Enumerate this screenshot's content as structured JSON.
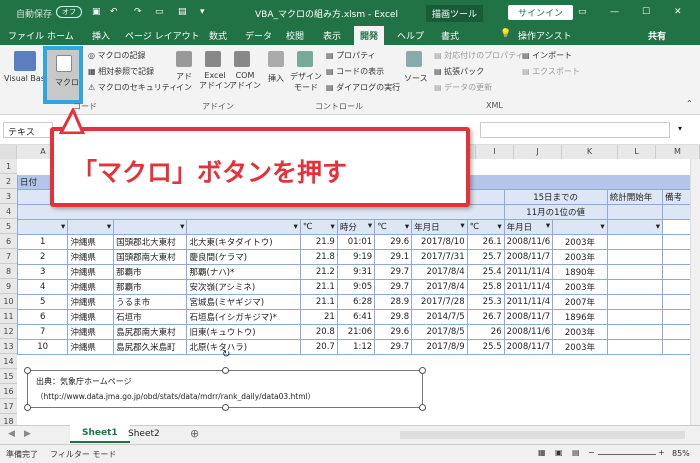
{
  "titlebar": {
    "autosave": "自動保存",
    "autosave_state": "オフ",
    "doc_title": "VBA_マクロの組み方.xlsm - Excel",
    "context_tab": "描画ツール",
    "signin": "サインイン"
  },
  "ribbon_tabs": [
    "ファイル",
    "ホーム",
    "挿入",
    "ページ レイアウト",
    "数式",
    "データ",
    "校閲",
    "表示",
    "開発",
    "ヘルプ",
    "書式"
  ],
  "tell_me": "操作アシスト",
  "share": "共有",
  "ribbon": {
    "visual_basic": "Visual Basic",
    "macro": "マクロ",
    "record_macro": "マクロの記録",
    "relative_ref": "相対参照で記録",
    "macro_security": "マクロのセキュリティ",
    "code_group": "コード",
    "addin": "アド\nイン",
    "excel_addin": "Excel\nアドイン",
    "com_addin": "COM\nアドイン",
    "addin_group": "アドイン",
    "insert": "挿入",
    "design_mode": "デザイン\nモード",
    "properties": "プロパティ",
    "view_code": "コードの表示",
    "run_dialog": "ダイアログの実行",
    "controls_group": "コントロール",
    "source": "ソース",
    "map_props": "対応付けのプロパティ",
    "expansion_pack": "拡張パック",
    "refresh_data": "データの更新",
    "import": "インポート",
    "export": "エクスポート",
    "xml_group": "XML"
  },
  "formula": {
    "namebox": "テキス"
  },
  "columns": [
    "A",
    "B",
    "C",
    "D",
    "E",
    "F",
    "G",
    "H",
    "I",
    "J",
    "K",
    "L",
    "M"
  ],
  "rows": [
    "1",
    "2",
    "3",
    "4",
    "5",
    "6",
    "7",
    "8",
    "9",
    "10",
    "11",
    "12",
    "13",
    "14",
    "15",
    "16",
    "17",
    "18"
  ],
  "header_cells": {
    "r2": "日付",
    "r3_j": "15日までの",
    "r4_j": "11月の1位の値",
    "r3_l": "統計開始年",
    "r3_m": "備考",
    "r5": [
      "",
      "",
      "",
      "",
      "℃",
      "時分",
      "℃",
      "年月日",
      "℃",
      "年月日",
      "",
      ""
    ]
  },
  "table_rows": [
    [
      "1",
      "沖縄県",
      "国頭郡北大東村",
      "北大東(キタダイトウ)",
      "21.9",
      "01:01",
      "29.6",
      "2017/8/10",
      "26.1",
      "2008/11/6",
      "2003年"
    ],
    [
      "2",
      "沖縄県",
      "国頭郡南大東村",
      "慶良間(ケラマ)",
      "21.8",
      "9:19",
      "29.1",
      "2017/7/31",
      "25.7",
      "2008/11/7",
      "2003年"
    ],
    [
      "3",
      "沖縄県",
      "那覇市",
      "那覇(ナハ)*",
      "21.2",
      "9:31",
      "29.7",
      "2017/8/4",
      "25.4",
      "2011/11/4",
      "1890年"
    ],
    [
      "4",
      "沖縄県",
      "那覇市",
      "安次嶺(アシミネ)",
      "21.1",
      "9:05",
      "29.7",
      "2017/8/4",
      "25.8",
      "2011/11/4",
      "2003年"
    ],
    [
      "5",
      "沖縄県",
      "うるま市",
      "宮城島(ミヤギジマ)",
      "21.1",
      "6:28",
      "28.9",
      "2017/7/28",
      "25.3",
      "2011/11/4",
      "2007年"
    ],
    [
      "6",
      "沖縄県",
      "石垣市",
      "石垣島(イシガキジマ)*",
      "21",
      "6:41",
      "29.8",
      "2014/7/5",
      "26.7",
      "2008/11/7",
      "1896年"
    ],
    [
      "7",
      "沖縄県",
      "島尻郡南大東村",
      "旧東(キュウトウ)",
      "20.8",
      "21:06",
      "29.6",
      "2017/8/5",
      "26",
      "2008/11/6",
      "2003年"
    ],
    [
      "10",
      "沖縄県",
      "島尻郡久米島町",
      "北原(キタハラ)",
      "20.7",
      "1:12",
      "29.7",
      "2017/8/9",
      "25.5",
      "2008/11/7",
      "2003年"
    ]
  ],
  "source_box": {
    "line1": "出典：気象庁ホームページ",
    "line2": "（http://www.data.jma.go.jp/obd/stats/data/mdrr/rank_daily/data03.html）"
  },
  "sheet_tabs": [
    "Sheet1",
    "Sheet2"
  ],
  "status": {
    "ready": "準備完了",
    "filter_mode": "フィルター モード",
    "zoom": "85%"
  },
  "callout": "「マクロ」ボタンを押す",
  "colors": {
    "excel_green": "#217346",
    "highlight": "#2ea7e0",
    "callout_red": "#e4323a",
    "table_header": "#b4c6e7"
  }
}
